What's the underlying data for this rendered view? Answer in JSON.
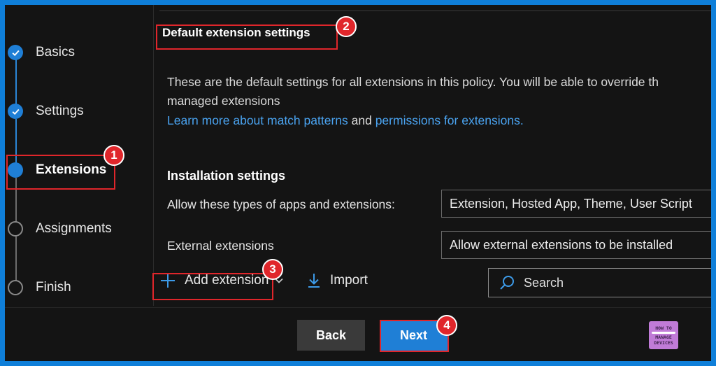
{
  "stepper": {
    "steps": [
      {
        "label": "Basics",
        "state": "done"
      },
      {
        "label": "Settings",
        "state": "done"
      },
      {
        "label": "Extensions",
        "state": "current"
      },
      {
        "label": "Assignments",
        "state": "todo"
      },
      {
        "label": "Finish",
        "state": "todo"
      }
    ]
  },
  "content": {
    "section_title": "Default extension settings",
    "description_line1": "These are the default settings for all extensions in this policy. You will be able to override th",
    "description_line2": "managed extensions",
    "link1": "Learn more about match patterns",
    "link_joiner": " and ",
    "link2": "permissions for extensions.",
    "installation_title": "Installation settings",
    "allow_types_label": "Allow these types of apps and extensions:",
    "allow_types_value": "Extension, Hosted App, Theme, User Script",
    "external_label": "External extensions",
    "external_value": "Allow external extensions to be installed"
  },
  "toolbar": {
    "add_label": "Add extension",
    "import_label": "Import",
    "search_placeholder": "Search"
  },
  "footer": {
    "back_label": "Back",
    "next_label": "Next"
  },
  "callouts": [
    "1",
    "2",
    "3",
    "4"
  ],
  "logo": {
    "top": "HOW TO",
    "bottom1": "MANAGE",
    "bottom2": "DEVICES"
  },
  "colors": {
    "accent": "#1f7fd6",
    "link": "#4aa3f0",
    "callout": "#e0262b",
    "frame": "#0f7fd9"
  }
}
